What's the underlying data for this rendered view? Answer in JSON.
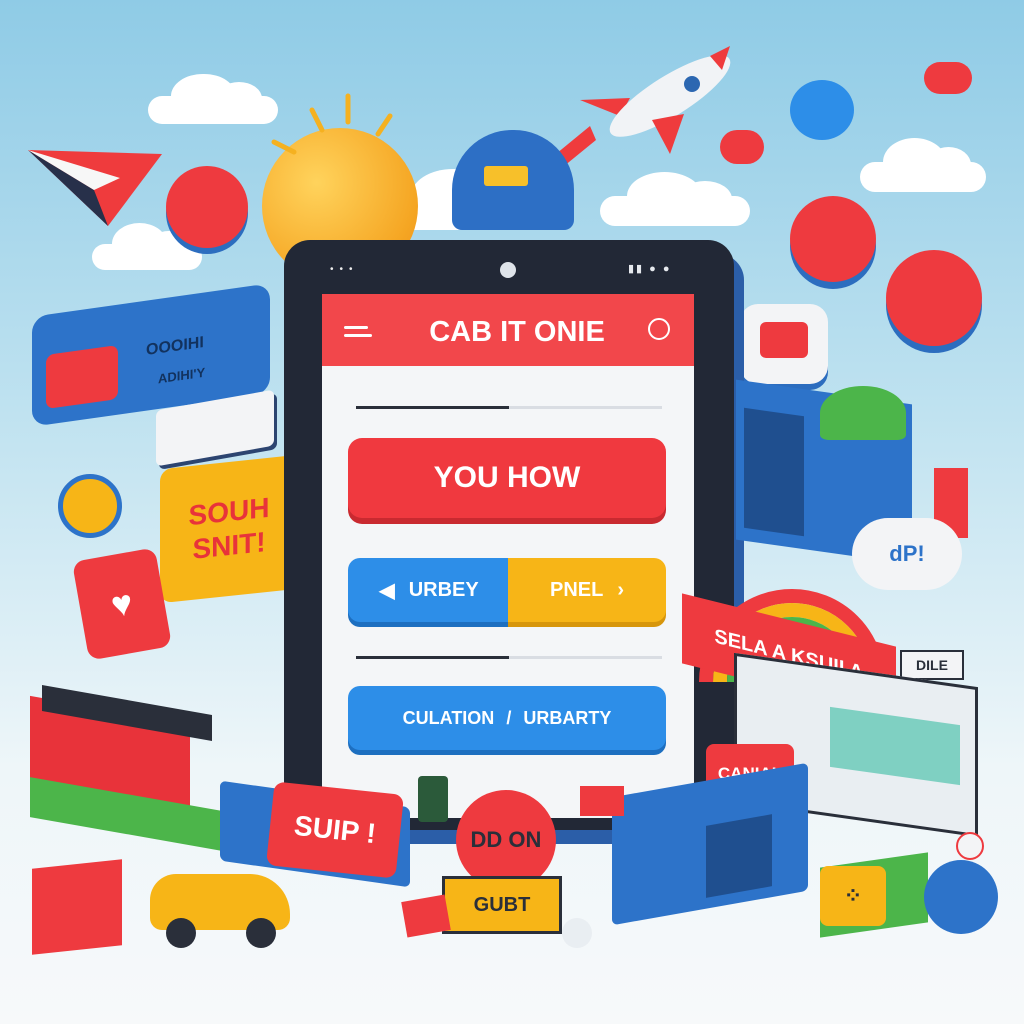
{
  "app": {
    "title": "CAB IT ONIE",
    "main_button": "YOU HOW",
    "left_button": "URBEY",
    "right_button": "PNEL",
    "bottom_button_left": "CULATION",
    "bottom_button_sep": "/",
    "bottom_button_right": "URBARTY",
    "progress_top": 0.5,
    "progress_bottom": 0.5
  },
  "signs": {
    "left_card_line1": "OOOIHI",
    "left_card_line2": "ADIHI'Y",
    "yellow_sign_line1": "SOUH",
    "yellow_sign_line2": "SNIT!",
    "red_sign": "SUIP !",
    "red_ball": "DD ON",
    "yellow_box": "GUBT",
    "rainbow_banner": "SELA A KSUII A",
    "right_small_sign": "DILE",
    "speech_sign": "CANIAL",
    "cloud_text": "dP!"
  },
  "colors": {
    "primary_red": "#f0393f",
    "primary_blue": "#2d8ee8",
    "accent_yellow": "#f7b517",
    "phone_body": "#222836"
  }
}
